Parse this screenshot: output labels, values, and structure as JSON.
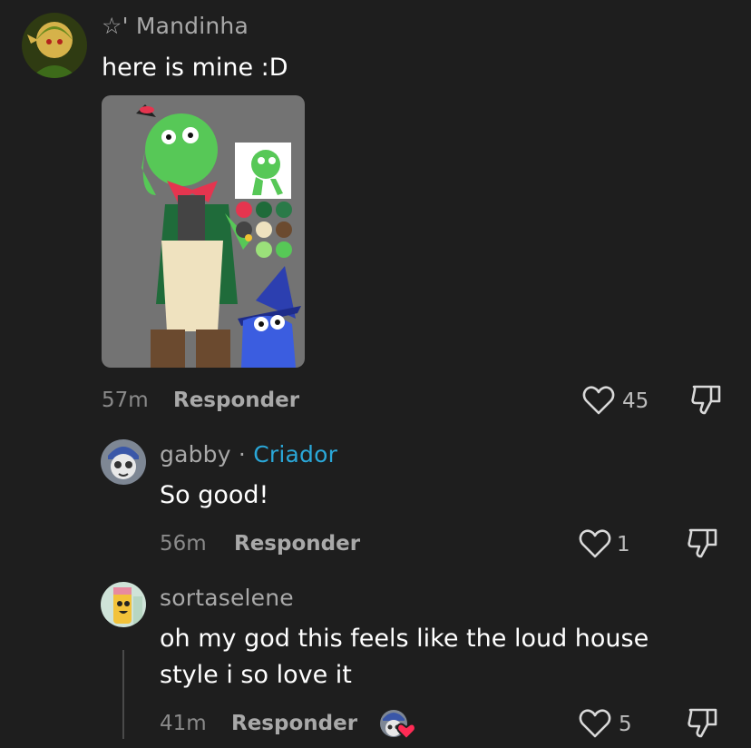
{
  "comments": [
    {
      "username": "☆' Mandinha",
      "text": "here is mine :D",
      "time": "57m",
      "reply_label": "Responder",
      "likes": "45"
    },
    {
      "username": "gabby",
      "separator": "·",
      "badge": "Criador",
      "text": "So good!",
      "time": "56m",
      "reply_label": "Responder",
      "likes": "1"
    },
    {
      "username": "sortaselene",
      "text_line1": "oh my god this feels like the loud house",
      "text_line2": "style i so love it",
      "time": "41m",
      "reply_label": "Responder",
      "likes": "5"
    }
  ],
  "colors": {
    "background": "#1e1e1e",
    "creator_badge": "#2aa7d8",
    "muted_text": "#a9a9a9"
  },
  "icons": [
    "heart-outline-icon",
    "thumbs-down-icon",
    "creator-liked-avatar-icon"
  ]
}
